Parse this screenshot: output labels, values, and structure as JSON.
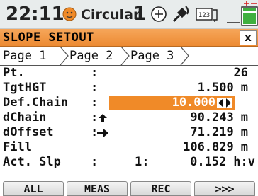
{
  "status": {
    "time": "22:11",
    "prism_label": "Circular",
    "face_number": "1",
    "icons": [
      "face-icon",
      "target-icon",
      "gps-icon",
      "keyboard-123-icon",
      "battery-icon"
    ],
    "keyboard_label": "123"
  },
  "title": {
    "text": "SLOPE SETOUT",
    "close": "x"
  },
  "tabs": [
    {
      "label": "Page 1",
      "active": true
    },
    {
      "label": "Page 2",
      "active": false
    },
    {
      "label": "Page 3",
      "active": false
    }
  ],
  "rows": {
    "pt": {
      "label": "Pt.",
      "colon": ":",
      "value": "26"
    },
    "tgthgt": {
      "label": "TgtHGT",
      "colon": ":",
      "value": "1.500",
      "unit": "m"
    },
    "defchain": {
      "label": "Def.Chain",
      "colon": ":",
      "value": "10.000",
      "unit": ""
    },
    "dchain": {
      "label": "dChain",
      "colon": ":",
      "value": "90.243",
      "unit": "m"
    },
    "doffset": {
      "label": "dOffset",
      "colon": ":",
      "value": "71.219",
      "unit": "m"
    },
    "fill": {
      "label": "Fill",
      "colon": "",
      "value": "106.829",
      "unit": "m"
    },
    "actslp": {
      "label": "Act. Slp",
      "colon": ":",
      "prefix": "1:",
      "value": "0.152",
      "unit": "h:v"
    }
  },
  "softkeys": [
    "ALL",
    "MEAS",
    "REC",
    ">>>"
  ],
  "colors": {
    "accent": "#f08a28",
    "titlebar": "#ec8a32",
    "statusbar": "#e8ecec"
  }
}
